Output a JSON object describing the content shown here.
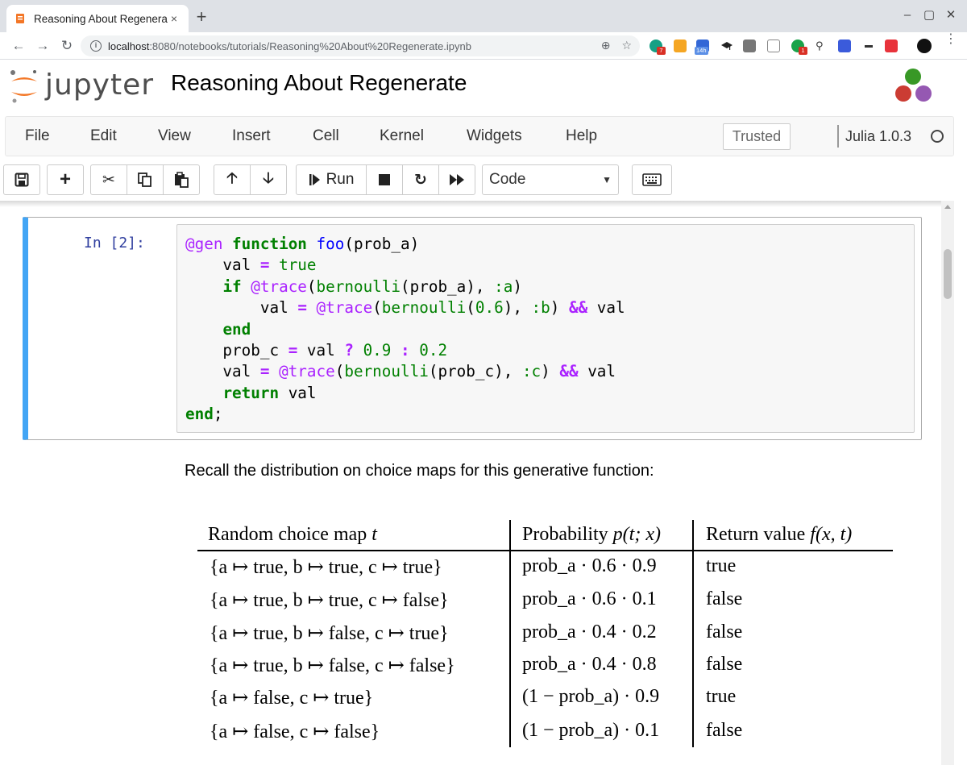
{
  "browser": {
    "tab_title": "Reasoning About Regenerate",
    "tab_close": "×",
    "new_tab": "+",
    "url_host": "localhost",
    "url_rest": ":8080/notebooks/tutorials/Reasoning%20About%20Regenerate.ipynb",
    "ext_badges": [
      "7",
      "14h",
      "1"
    ]
  },
  "jupyter": {
    "logo_text": "jupyter",
    "notebook_title": "Reasoning About Regenerate",
    "menu": [
      "File",
      "Edit",
      "View",
      "Insert",
      "Cell",
      "Kernel",
      "Widgets",
      "Help"
    ],
    "trusted_label": "Trusted",
    "kernel_name": "Julia 1.0.3",
    "run_label": "Run",
    "cell_type": "Code"
  },
  "cell": {
    "prompt": "In [2]:"
  },
  "markdown": {
    "intro": "Recall the distribution on choice maps for this generative function:"
  },
  "table": {
    "headers": {
      "c1_text": "Random choice map ",
      "c1_var": "t",
      "c2_text": "Probability ",
      "c2_math": "p(t; x)",
      "c3_text": "Return value ",
      "c3_math": "f(x, t)"
    },
    "rows": [
      {
        "map": "{a ↦ true, b ↦ true, c ↦ true}",
        "prob": "prob_a · 0.6 · 0.9",
        "ret": "true"
      },
      {
        "map": "{a ↦ true, b ↦ true, c ↦ false}",
        "prob": "prob_a · 0.6 · 0.1",
        "ret": "false"
      },
      {
        "map": "{a ↦ true, b ↦ false, c ↦ true}",
        "prob": "prob_a · 0.4 · 0.2",
        "ret": "false"
      },
      {
        "map": "{a ↦ true, b ↦ false, c ↦ false}",
        "prob": "prob_a · 0.4 · 0.8",
        "ret": "false"
      },
      {
        "map": "{a ↦ false, c ↦ true}",
        "prob": "(1 − prob_a) · 0.9",
        "ret": "true"
      },
      {
        "map": "{a ↦ false, c ↦ false}",
        "prob": "(1 − prob_a) · 0.1",
        "ret": "false"
      }
    ]
  },
  "colors": {
    "cell_selected_border": "#42a5f5",
    "prompt": "#303f9f",
    "keyword": "#008000",
    "macro": "#aa22ff"
  }
}
